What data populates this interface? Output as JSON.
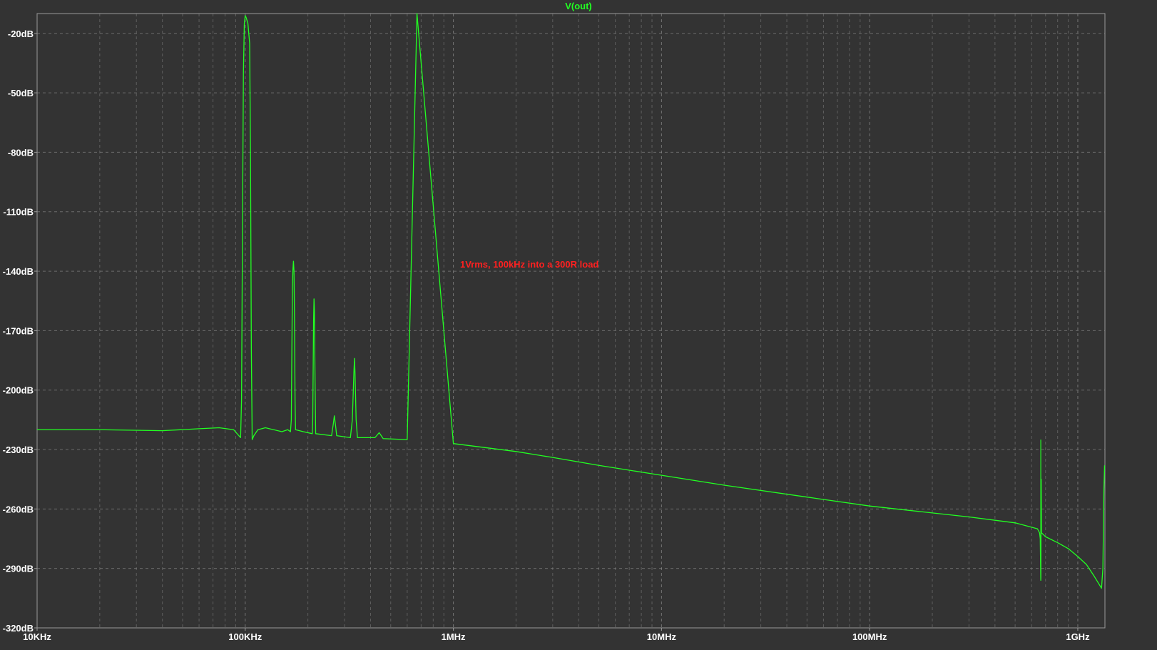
{
  "colors": {
    "background": "#333333",
    "plot_border": "#9a9a9a",
    "grid": "#8a8a8a",
    "tick_label": "#ffffff",
    "trace": "#22ff22",
    "annotation": "#ff2020"
  },
  "chart_data": {
    "type": "line",
    "title": "V(out)",
    "annotation": "1Vrms, 100kHz into a 300R load",
    "x_scale": "log",
    "xlim_hz": [
      10000,
      1350000000
    ],
    "ylim_db": [
      -320,
      -10
    ],
    "grid": true,
    "x_ticks": [
      {
        "value": 10000,
        "label": "10KHz"
      },
      {
        "value": 100000,
        "label": "100KHz"
      },
      {
        "value": 1000000,
        "label": "1MHz"
      },
      {
        "value": 10000000,
        "label": "10MHz"
      },
      {
        "value": 100000000,
        "label": "100MHz"
      },
      {
        "value": 1000000000,
        "label": "1GHz"
      }
    ],
    "y_ticks": [
      {
        "value": -20,
        "label": "-20dB"
      },
      {
        "value": -50,
        "label": "-50dB"
      },
      {
        "value": -80,
        "label": "-80dB"
      },
      {
        "value": -110,
        "label": "-110dB"
      },
      {
        "value": -140,
        "label": "-140dB"
      },
      {
        "value": -170,
        "label": "-170dB"
      },
      {
        "value": -200,
        "label": "-200dB"
      },
      {
        "value": -230,
        "label": "-230dB"
      },
      {
        "value": -260,
        "label": "-260dB"
      },
      {
        "value": -290,
        "label": "-290dB"
      },
      {
        "value": -320,
        "label": "-320dB"
      }
    ],
    "series": [
      {
        "name": "V(out)",
        "points": [
          [
            10000,
            -220
          ],
          [
            20000,
            -220
          ],
          [
            40000,
            -220.5
          ],
          [
            60000,
            -219.5
          ],
          [
            75000,
            -219
          ],
          [
            88000,
            -220
          ],
          [
            95000,
            -224
          ],
          [
            96000,
            -205
          ],
          [
            97000,
            -120
          ],
          [
            98000,
            -40
          ],
          [
            99000,
            -15
          ],
          [
            100000,
            -11
          ],
          [
            101000,
            -12
          ],
          [
            103000,
            -15
          ],
          [
            105000,
            -25
          ],
          [
            106000,
            -80
          ],
          [
            107000,
            -180
          ],
          [
            108000,
            -225
          ],
          [
            110000,
            -223
          ],
          [
            115000,
            -220
          ],
          [
            125000,
            -219
          ],
          [
            150000,
            -221
          ],
          [
            160000,
            -220
          ],
          [
            165000,
            -221
          ],
          [
            166500,
            -215
          ],
          [
            167500,
            -180
          ],
          [
            168500,
            -148
          ],
          [
            169500,
            -139
          ],
          [
            170500,
            -135
          ],
          [
            171500,
            -140
          ],
          [
            172500,
            -165
          ],
          [
            173500,
            -205
          ],
          [
            174500,
            -220
          ],
          [
            190000,
            -221
          ],
          [
            210000,
            -222
          ],
          [
            211000,
            -215
          ],
          [
            212000,
            -190
          ],
          [
            213000,
            -165
          ],
          [
            214000,
            -154
          ],
          [
            215000,
            -160
          ],
          [
            216500,
            -195
          ],
          [
            218000,
            -222
          ],
          [
            260000,
            -223
          ],
          [
            265000,
            -217
          ],
          [
            268000,
            -213
          ],
          [
            271000,
            -217
          ],
          [
            275000,
            -223
          ],
          [
            320000,
            -224
          ],
          [
            327000,
            -215
          ],
          [
            333000,
            -190
          ],
          [
            335000,
            -184
          ],
          [
            337000,
            -192
          ],
          [
            341000,
            -215
          ],
          [
            346000,
            -224
          ],
          [
            420000,
            -224
          ],
          [
            440000,
            -221.5
          ],
          [
            460000,
            -224.5
          ],
          [
            600000,
            -225
          ],
          [
            1000000,
            -227
          ],
          [
            2000000,
            -231
          ],
          [
            3000000,
            -234
          ],
          [
            5000000,
            -238
          ],
          [
            10000000,
            -243
          ],
          [
            20000000,
            -248
          ],
          [
            50000000,
            -254
          ],
          [
            100000000,
            -258.5
          ],
          [
            200000000,
            -262
          ],
          [
            300000000,
            -264
          ],
          [
            500000000,
            -267
          ],
          [
            640000000,
            -270
          ],
          [
            655000000,
            -272
          ],
          [
            660000000,
            -275
          ],
          [
            664000000,
            -296
          ],
          [
            667000000,
            -245
          ],
          [
            668500,
            0
          ]
        ],
        "segments_note": ""
      }
    ]
  }
}
